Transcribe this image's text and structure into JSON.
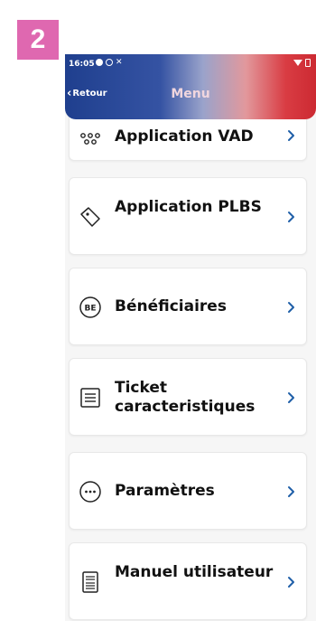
{
  "step_badge": "2",
  "status_bar": {
    "time": "16:05",
    "icons": [
      "notification-dot-icon",
      "circle-icon",
      "x-icon",
      "wifi-icon",
      "battery-icon"
    ]
  },
  "header": {
    "back_label": "Retour",
    "title": "Menu",
    "gradient_colors": [
      "#1f3f8e",
      "#d93c43"
    ]
  },
  "menu": {
    "items": [
      {
        "label": "Application VAD",
        "icon": "dots-network-icon"
      },
      {
        "label": "Application PLBS",
        "icon": "tag-icon"
      },
      {
        "label": "Bénéficiaires",
        "icon": "be-badge-icon"
      },
      {
        "label": "Ticket caracteristiques",
        "icon": "receipt-icon"
      },
      {
        "label": "Paramètres",
        "icon": "more-circle-icon"
      },
      {
        "label": "Manuel utilisateur",
        "icon": "manual-book-icon"
      }
    ]
  },
  "colors": {
    "accent": "#1f5fa8",
    "badge": "#df68b0"
  }
}
